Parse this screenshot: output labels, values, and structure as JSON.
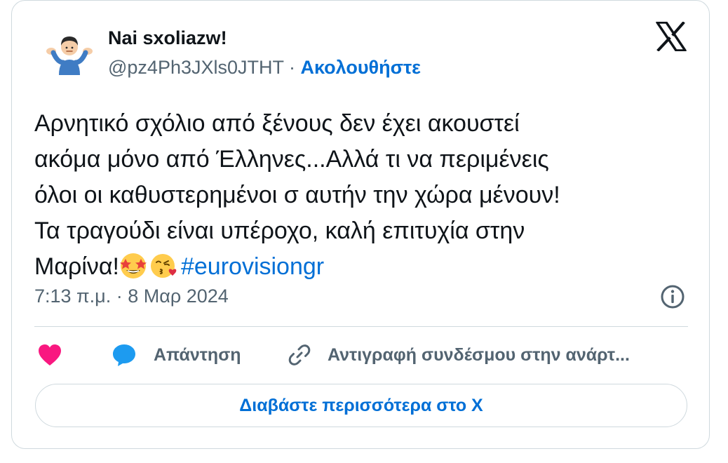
{
  "author": {
    "display_name": "Nai sxoliazw!",
    "handle": "@pz4Ph3JXls0JTHT",
    "separator": " · ",
    "follow_label": "Ακολουθήστε"
  },
  "tweet": {
    "lines": [
      "Αρνητικό σχόλιο από ξένους δεν έχει ακουστεί",
      "ακόμα μόνο από Έλληνες...Αλλά τι να περιμένεις",
      "όλοι οι καθυστερημένοι σ αυτήν την χώρα μένουν!",
      "Τα τραγούδι είναι υπέροχο, καλή επιτυχία στην",
      "Μαρίνα!"
    ],
    "hashtag": "#eurovisiongr",
    "emojis": [
      "star-struck",
      "face-blowing-a-kiss"
    ],
    "timestamp": "7:13 π.μ. · 8 Μαρ 2024"
  },
  "actions": {
    "reply_label": "Απάντηση",
    "copy_link_label": "Αντιγραφή συνδέσμου στην ανάρτ..."
  },
  "read_more_label": "Διαβάστε περισσότερα στο X",
  "colors": {
    "accent": "#006fd6",
    "secondary_text": "#536471",
    "border": "#cfd9de",
    "heart": "#f91880",
    "reply_bubble": "#1d9bf0"
  },
  "icons": [
    "avatar-shrug-emoji",
    "x-logo-icon",
    "info-icon",
    "heart-icon",
    "reply-icon",
    "link-icon"
  ]
}
